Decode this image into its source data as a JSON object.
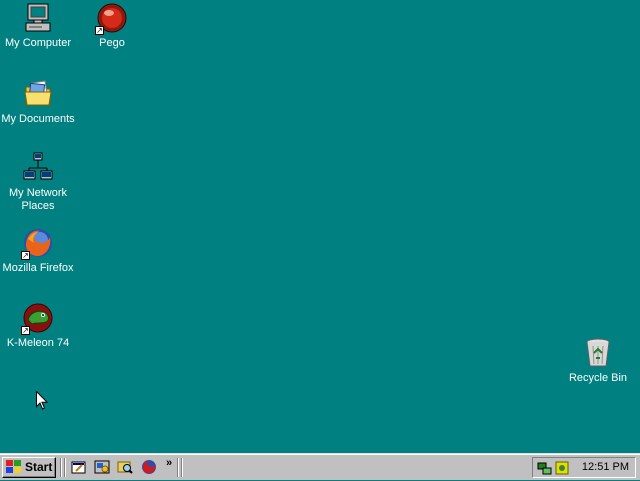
{
  "desktop": {
    "background_color": "#008080",
    "icons": [
      {
        "id": "my-computer",
        "label": "My Computer",
        "icon": "computer-icon"
      },
      {
        "id": "pego",
        "label": "Pego",
        "icon": "red-ball-icon",
        "shortcut": true
      },
      {
        "id": "my-documents",
        "label": "My Documents",
        "icon": "folder-documents-icon"
      },
      {
        "id": "my-network-places",
        "label_line1": "My Network",
        "label_line2": "Places",
        "icon": "network-icon"
      },
      {
        "id": "mozilla-firefox",
        "label": "Mozilla Firefox",
        "icon": "firefox-icon",
        "shortcut": true
      },
      {
        "id": "k-meleon",
        "label": "K-Meleon 74",
        "icon": "chameleon-icon",
        "shortcut": true
      },
      {
        "id": "recycle-bin",
        "label": "Recycle Bin",
        "icon": "recycle-bin-icon"
      }
    ]
  },
  "taskbar": {
    "start_label": "Start",
    "quick_launch": [
      "show-desktop-icon",
      "internet-explorer-icon",
      "windows-explorer-icon",
      "firefox-icon"
    ],
    "quick_launch_more": "»",
    "tray_icons": [
      "network-tray-icon",
      "security-tray-icon"
    ],
    "clock": "12:51 PM"
  }
}
